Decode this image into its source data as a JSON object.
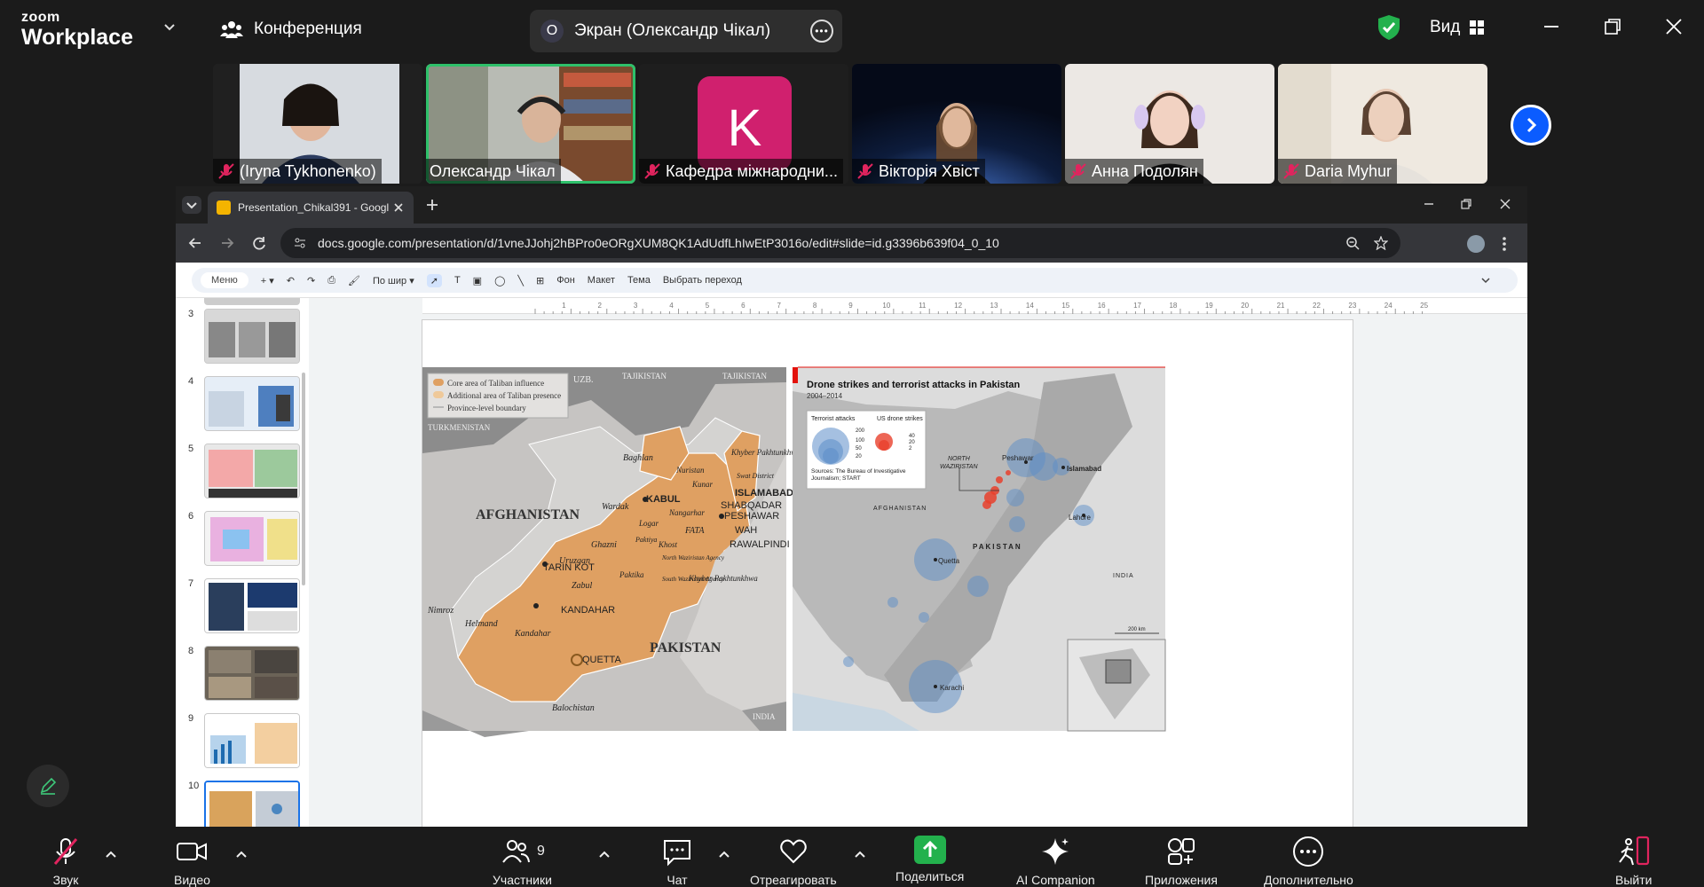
{
  "top": {
    "brand_small": "zoom",
    "brand_large": "Workplace",
    "meeting_label": "Конференция",
    "share_avatar": "О",
    "share_label": "Экран (Олександр Чікал)",
    "view_label": "Вид"
  },
  "participants": [
    {
      "name": "(Iryna Tykhonenko)",
      "muted": true
    },
    {
      "name": "Олександр Чікал",
      "muted": false,
      "active_speaker": true
    },
    {
      "name": "Кафедра міжнародни...",
      "muted": true,
      "initial": "K"
    },
    {
      "name": "Вікторія Хвіст",
      "muted": true
    },
    {
      "name": "Анна Подолян",
      "muted": true
    },
    {
      "name": "Daria Myhur",
      "muted": true
    }
  ],
  "browser": {
    "tab_title": "Presentation_Chikal391 - Googl",
    "url": "docs.google.com/presentation/d/1vneJJohj2hBPro0eORgXUM8QK1AdUdfLhIwEtP3016o/edit#slide=id.g3396b639f04_0_10"
  },
  "slides_toolbar": {
    "menus_label": "Меню",
    "zoom_label": "По шир ▾",
    "background": "Фон",
    "layout": "Макет",
    "theme": "Тема",
    "transition": "Выбрать переход"
  },
  "filmstrip": [
    "3",
    "4",
    "5",
    "6",
    "7",
    "8",
    "9",
    "10"
  ],
  "ruler_ticks": [
    "1",
    "2",
    "3",
    "4",
    "5",
    "6",
    "7",
    "8",
    "9",
    "10",
    "11",
    "12",
    "13",
    "14",
    "15",
    "16",
    "17",
    "18",
    "19",
    "20",
    "21",
    "22",
    "23",
    "24",
    "25"
  ],
  "slide": {
    "map_left": {
      "legend": [
        "Core area of Taliban influence",
        "Additional area of Taliban presence",
        "Province-level boundary"
      ],
      "labels": {
        "afghanistan": "AFGHANISTAN",
        "pakistan": "PAKISTAN",
        "kabul": "KABUL",
        "kandahar": "KANDAHAR",
        "tarin_kot": "TARIN KOT",
        "quetta": "QUETTA",
        "peshawar": "PESHAWAR",
        "shabqadar": "SHABQADAR",
        "islamabad": "ISLAMABAD",
        "wah": "WAH",
        "rawalpindi": "RAWALPINDI",
        "baghlan": "Baghlan",
        "balochistan": "Balochistan",
        "helmand": "Helmand",
        "nimroz": "Nimroz",
        "kandahar_prov": "Kandahar",
        "zabul": "Zabul",
        "uruzgan": "Uruzgan",
        "ghazni": "Ghazni",
        "wardak": "Wardak",
        "logar": "Logar",
        "paktiya": "Paktiya",
        "paktika": "Paktika",
        "khost": "Khost",
        "nangarhar": "Nangarhar",
        "fata": "FATA",
        "nuristan": "Nuristan",
        "kunar": "Kunar",
        "khyber_pakhtunkhwa_n": "Khyber Pakhtunkhwa",
        "swat": "Swat District",
        "khyber_pakhtunkhwa_s": "Khyber Pakhtunkhwa",
        "north_waziristan": "North Waziristan Agency",
        "south_waziristan": "South Waziristan Agency",
        "uzb": "UZB.",
        "tajikistan_a": "TAJIKISTAN",
        "tajikistan_b": "TAJIKISTAN",
        "turkmenistan": "TURKMENISTAN",
        "india": "INDIA"
      }
    },
    "map_right": {
      "title": "Drone strikes and terrorist attacks in Pakistan",
      "subtitle": "2004–2014",
      "legend": {
        "attacks_label": "Terrorist attacks",
        "drone_label": "US drone strikes",
        "attack_sizes": [
          "200",
          "100",
          "50",
          "20"
        ],
        "drone_sizes": [
          "40",
          "20",
          "2"
        ],
        "sources_1": "Sources: The Bureau of Investigative",
        "sources_2": "Journalism; START"
      },
      "labels": {
        "peshawar": "Peshawar",
        "islamabad": "Islamabad",
        "lahore": "Lahore",
        "quetta": "Quetta",
        "karachi": "Karachi",
        "north_waziristan_1": "NORTH",
        "north_waziristan_2": "WAZIRISTAN",
        "afghanistan": "AFGHANISTAN",
        "pakistan": "PAKISTAN",
        "india": "INDIA"
      },
      "scale": "200 km",
      "colors": {
        "attacks": "#5b8dc8",
        "drone_strikes": "#e8402c",
        "accent": "#e3120b"
      }
    }
  },
  "controls": {
    "audio": "Звук",
    "video": "Видео",
    "participants": "Участники",
    "participants_count": "9",
    "chat": "Чат",
    "react": "Отреагировать",
    "share": "Поделиться",
    "ai": "AI Companion",
    "apps": "Приложения",
    "more": "Дополнительно",
    "leave": "Выйти"
  },
  "colors": {
    "zoom_bg": "#1b1b1b",
    "active_speaker": "#2ec06a",
    "share_green": "#23b14d",
    "zoom_blue": "#0b5cff",
    "mute_red": "#e0245e"
  }
}
